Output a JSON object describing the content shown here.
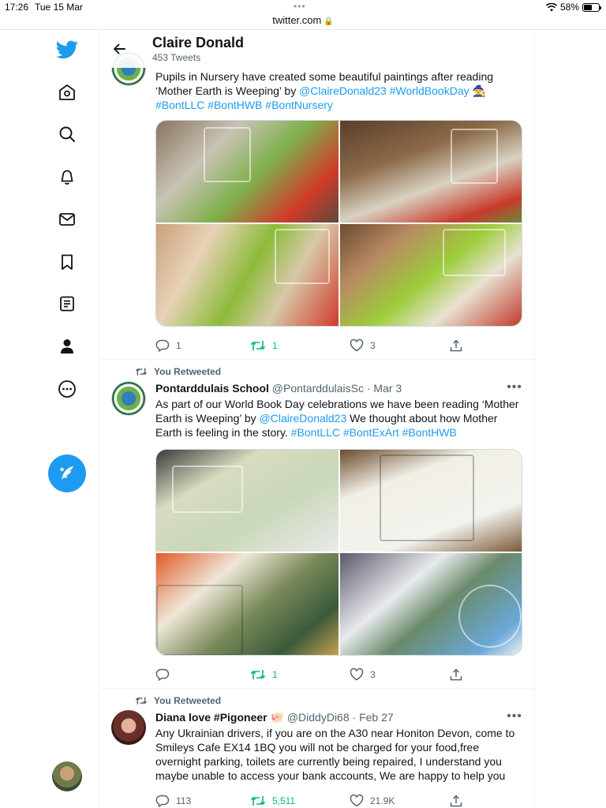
{
  "status_bar": {
    "time": "17:26",
    "date": "Tue 15 Mar",
    "battery": "58%",
    "battery_level": 0.58
  },
  "browser": {
    "url": "twitter.com"
  },
  "nav": {
    "icons": [
      "twitter-logo-icon",
      "home-icon",
      "explore-icon",
      "notifications-icon",
      "messages-icon",
      "bookmarks-icon",
      "lists-icon",
      "profile-icon",
      "more-icon"
    ],
    "compose_icon": "compose-icon"
  },
  "header": {
    "title": "Claire Donald",
    "tweet_count": "453 Tweets"
  },
  "tweets": [
    {
      "text_1": "Pupils in Nursery have created some beautiful paintings after reading ‘Mother Earth is Weeping’ by ",
      "mention": "@ClaireDonald23",
      "hashtags_inline": " #WorldBookDay ",
      "hashtags_line2": "#BontLLC #BontHWB #BontNursery",
      "replies": "1",
      "retweets": "1",
      "likes": "3"
    },
    {
      "retweet_label": "You Retweeted",
      "name": "Pontarddulais School",
      "handle": "@PontarddulaisSc",
      "date": "Mar 3",
      "text_1": "As part of our World Book Day celebrations we have been reading ‘Mother Earth is Weeping’ by ",
      "mention": "@ClaireDonald23",
      "text_2": " We thought about how Mother Earth is feeling in the story. ",
      "hashtags": "#BontLLC #BontExArt #BontHWB",
      "replies": "",
      "retweets": "1",
      "likes": "3"
    },
    {
      "retweet_label": "You Retweeted",
      "name": "Diana love #Pigoneer",
      "handle": "@DiddyDi68",
      "date": "Feb 27",
      "text": "Any Ukrainian drivers, if you are on the A30 near Honiton Devon, come to Smileys Cafe EX14 1BQ you will not be charged for your food,free overnight parking, toilets are currently being repaired, I understand you maybe unable to access your bank accounts, We are happy to help you",
      "replies": "113",
      "retweets": "5,511",
      "likes": "21.9K"
    }
  ],
  "colors": {
    "accent": "#1d9bf0",
    "retweet_green": "#00ba7c",
    "muted": "#536471"
  }
}
